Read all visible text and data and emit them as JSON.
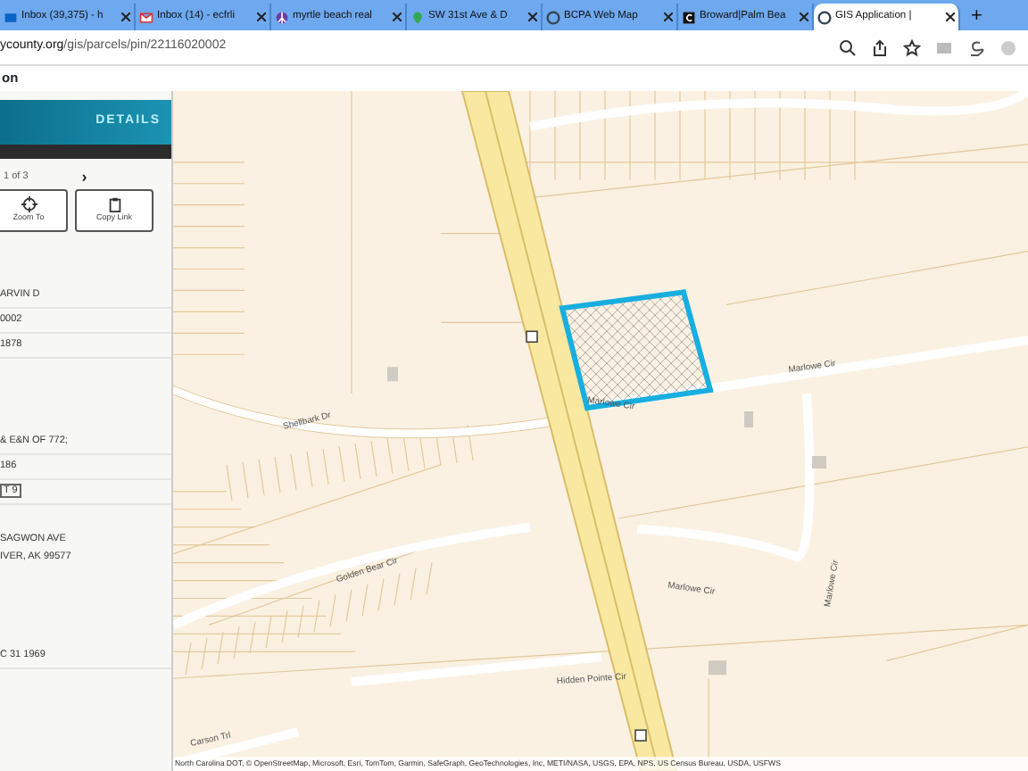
{
  "browser": {
    "tabs": [
      {
        "title": "Inbox (39,375) - h",
        "selected": false
      },
      {
        "title": "Inbox (14) - ecfrli",
        "selected": false
      },
      {
        "title": "myrtle beach real",
        "selected": false
      },
      {
        "title": "SW 31st Ave & D",
        "selected": false
      },
      {
        "title": "BCPA Web Map",
        "selected": false
      },
      {
        "title": "Broward|Palm Bea",
        "selected": false
      },
      {
        "title": "GIS Application | ",
        "selected": true
      }
    ],
    "new_tab": "+",
    "address": {
      "domain": "ycounty.org",
      "path": "/gis/parcels/pin/22116020002"
    }
  },
  "page_title": "on",
  "sidebar": {
    "header": "DETAILS",
    "pager": {
      "text": "1 of 3",
      "next": "›"
    },
    "buttons": [
      {
        "label": "Zoom To"
      },
      {
        "label": "Copy Link"
      }
    ],
    "groups": [
      [
        {
          "text": "ARVIN D",
          "kind": "plain"
        },
        {
          "text": "0002",
          "kind": "plain"
        },
        {
          "text": "1878",
          "kind": "plain"
        }
      ],
      [
        {
          "text": "& E&N OF 772;",
          "kind": "plain"
        },
        {
          "text": "186",
          "kind": "plain"
        },
        {
          "text": "T 9",
          "kind": "boxed"
        }
      ],
      [
        {
          "text": "SAGWON AVE",
          "kind": "line"
        },
        {
          "text": "IVER, AK 99577",
          "kind": "line"
        }
      ],
      [
        {
          "text": "C 31 1969",
          "kind": "plain"
        }
      ]
    ]
  },
  "map": {
    "street_labels": [
      {
        "text": "Shellbark Dr"
      },
      {
        "text": "Marlowe Cir"
      },
      {
        "text": "Marlowe Cir"
      },
      {
        "text": "Marlowe Cir"
      },
      {
        "text": "Golden Bear Cir"
      },
      {
        "text": "Marlowe Cir"
      },
      {
        "text": "Hidden Pointe Cir"
      },
      {
        "text": "Carson Trl"
      }
    ],
    "attribution": "North Carolina DOT, © OpenStreetMap, Microsoft, Esri, TomTom, Garmin, SafeGraph, GeoTechnologies, Inc, METI/NASA, USGS, EPA, NPS, US Census Bureau, USDA, USFWS"
  }
}
